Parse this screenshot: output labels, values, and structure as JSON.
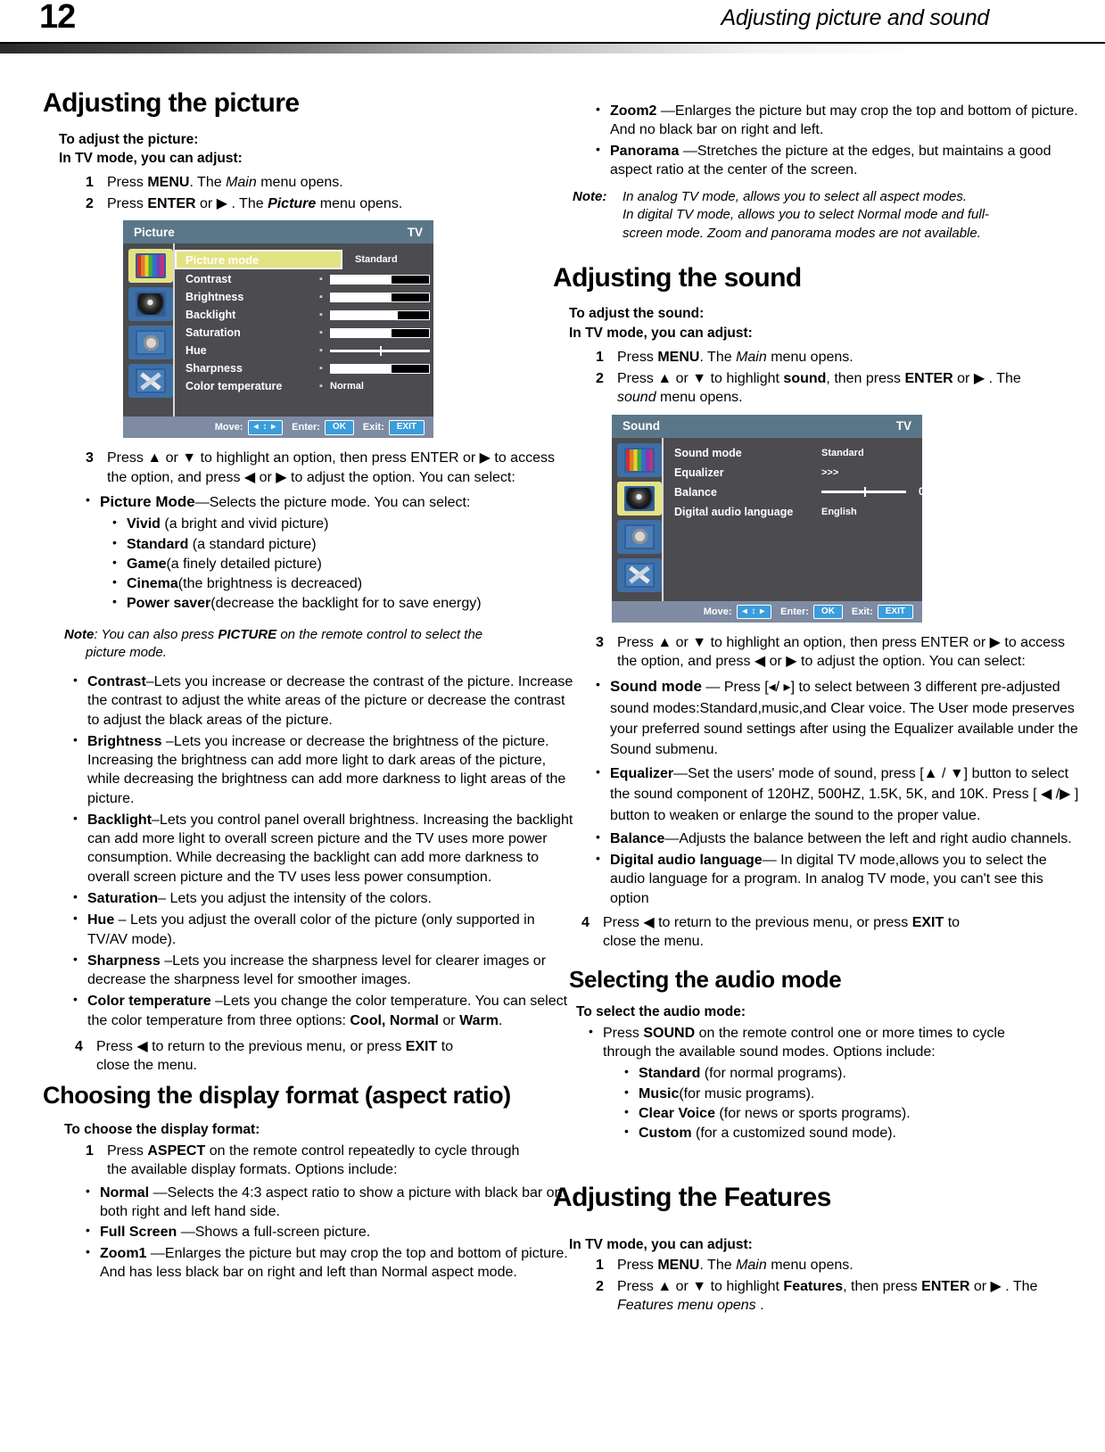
{
  "header": {
    "page_number": "12",
    "running_title": "Adjusting picture and sound"
  },
  "left_column": {
    "section_title": "Adjusting the picture",
    "lead1": "To adjust the picture:",
    "lead2": "In TV mode, you can adjust:",
    "steps": [
      {
        "num": "1",
        "text_1": "Press ",
        "bold_1": "MENU",
        "text_2": ". The ",
        "italic_1": "Main",
        "text_3": " menu opens."
      },
      {
        "num": "2",
        "text_1": "Press ",
        "bold_1": "ENTER",
        "text_2": " or ▶ . The ",
        "italic_1": "Picture",
        "text_3": "  menu opens."
      }
    ],
    "picture_osd": {
      "title": "Picture",
      "source": "TV",
      "rows": [
        {
          "label": "Picture mode",
          "value": "Standard",
          "type": "highlight"
        },
        {
          "label": "Contrast",
          "value": "50",
          "type": "bar",
          "fill_pct": 62
        },
        {
          "label": "Brightness",
          "value": "50",
          "type": "bar",
          "fill_pct": 62
        },
        {
          "label": "Backlight",
          "value": "5",
          "type": "bar",
          "fill_pct": 68
        },
        {
          "label": "Saturation",
          "value": "50",
          "type": "bar",
          "fill_pct": 62
        },
        {
          "label": "Hue",
          "value": "0",
          "type": "center",
          "fill_pct": 50
        },
        {
          "label": "Sharpness",
          "value": "5",
          "type": "bar",
          "fill_pct": 62
        },
        {
          "label": "Color temperature",
          "value": "Normal",
          "type": "text"
        }
      ],
      "footer": {
        "move_label": "Move:",
        "move_key": "◂ ↕ ▸",
        "enter_label": "Enter:",
        "enter_key": "OK",
        "exit_label": "Exit:",
        "exit_key": "EXIT"
      }
    },
    "step3": {
      "num": "3",
      "line1": "Press ▲ or ▼ to highlight an option, then press ENTER or ▶ to access",
      "line2": "the option, and press ◀ or ▶ to adjust  the option. You can select:"
    },
    "picture_mode_bullet": {
      "term": "Picture Mode",
      "desc": "—Selects the picture mode. You can select:",
      "options": [
        {
          "term": "Vivid",
          "desc": " (a bright and vivid picture)"
        },
        {
          "term": "Standard",
          "desc": " (a standard picture)"
        },
        {
          "term": "Game",
          "desc": "(a finely detailed picture)"
        },
        {
          "term": "Cinema",
          "desc": "(the brightness is decreaced)"
        },
        {
          "term": "Power saver",
          "desc": "(decrease the backlight for to save energy)"
        }
      ]
    },
    "note": {
      "label": "Note",
      "line1_a": ": You can also press ",
      "line1_b": "PICTURE",
      "line1_c": " on the remote control to select the",
      "line2": "picture mode."
    },
    "option_bullets": [
      {
        "term": "Contrast",
        "desc": "–Lets you increase or decrease the contrast of the picture. Increase the contrast to adjust the white areas of the picture or decrease the contrast to adjust the black areas of the picture."
      },
      {
        "term": "Brightness",
        "desc": " –Lets you increase or decrease the brightness of the picture. Increasing the brightness can add more light to dark areas of the picture, while decreasing the brightness can add more darkness to light areas of the picture."
      },
      {
        "term": "Backlight",
        "desc": "–Lets you control panel overall brightness. Increasing the backlight can add more light to overall screen picture and the TV uses more power consumption. While decreasing the backlight can add more darkness to overall screen picture and the TV uses less power consumption."
      },
      {
        "term": "Saturation",
        "desc": "– Lets you adjust the intensity of the colors."
      },
      {
        "term": "Hue",
        "desc": " – Lets you adjust the overall color of the picture (only supported in TV/AV mode)."
      },
      {
        "term": "Sharpness",
        "desc": " –Lets you increase the sharpness level for clearer images or decrease the sharpness level for smoother images."
      },
      {
        "term": "Color temperature",
        "desc": " –Lets you change the color temperature. You can select the color temperature from three options: ",
        "bold_tail": "Cool,  Normal",
        "tail_mid": " or ",
        "bold_tail2": "Warm",
        "tail_end": "."
      }
    ],
    "step4": {
      "num": "4",
      "line1_a": "Press ◀ to return to the previous menu, or press  ",
      "line1_b": "EXIT",
      "line1_c": " to",
      "line2": "close the menu."
    },
    "aspect_section": {
      "title": "Choosing the display format (aspect ratio)",
      "lead": "To choose the display format:",
      "step1": {
        "num": "1",
        "line1_a": "Press ",
        "line1_b": "ASPECT",
        "line1_c": " on the remote control repeatedly to cycle through",
        "line2": "the available display formats. Options include:"
      },
      "options": [
        {
          "term": "Normal",
          "desc": " —Selects the 4:3 aspect ratio to show a picture with black bar on both right and left hand side."
        },
        {
          "term": "Full Screen",
          "desc": " —Shows a full-screen picture."
        },
        {
          "term": "Zoom1",
          "desc": " —Enlarges the picture but may crop the top and bottom of picture. And has less black bar on right and left than Normal aspect mode."
        }
      ]
    }
  },
  "right_column": {
    "aspect_continued": [
      {
        "term": "Zoom2",
        "desc": " —Enlarges the picture but may crop the top and bottom of picture. And no black bar on right and left."
      },
      {
        "term": "Panorama",
        "desc": "   —Stretches the picture at the edges, but maintains a good aspect ratio at the center  of the screen."
      }
    ],
    "aspect_note": {
      "label": "Note:",
      "line1": "In analog TV mode, allows you to select all aspect modes.",
      "line2": "In digital TV mode, allows you to select Normal mode and full-",
      "line3": "screen mode. Zoom and panorama modes are not available."
    },
    "sound_section": {
      "title": "Adjusting the sound",
      "lead1": "To adjust the sound:",
      "lead2": "In TV mode, you can adjust:",
      "steps": [
        {
          "num": "1",
          "text_1": "Press ",
          "bold_1": "MENU",
          "text_2": ". The ",
          "italic_1": "Main",
          "text_3": " menu opens."
        },
        {
          "num": "2",
          "text_1": "Press ▲ or ▼ to highlight ",
          "bold_1": "sound",
          "text_2": ", then press ",
          "bold_2": "ENTER",
          "text_3": " or ▶ . The ",
          "italic_1": "sound",
          "text_4": " menu opens."
        }
      ],
      "sound_osd": {
        "title": "Sound",
        "source": "TV",
        "rows": [
          {
            "label": "Sound mode",
            "value": "Standard",
            "type": "text"
          },
          {
            "label": "Equalizer",
            "value": ">>>",
            "type": "text"
          },
          {
            "label": "Balance",
            "value": "0",
            "type": "center",
            "fill_pct": 50
          },
          {
            "label": "Digital audio language",
            "value": "English",
            "type": "text"
          }
        ],
        "footer": {
          "move_label": "Move:",
          "move_key": "◂ ↕ ▸",
          "enter_label": "Enter:",
          "enter_key": "OK",
          "exit_label": "Exit:",
          "exit_key": "EXIT"
        }
      },
      "step3": {
        "num": "3",
        "line1": "Press ▲ or ▼ to highlight an option, then press ENTER or ▶ to access",
        "line2": "the option, and press ◀ or ▶ to adjust  the option. You can select:"
      },
      "option_bullets": [
        {
          "term": "Sound mode",
          "desc": "  — Press [◂/ ▸] to select between 3 different pre-adjusted sound modes:Standard,music,and Clear voice. The User mode preserves your preferred sound settings after using the Equalizer available under the Sound submenu."
        },
        {
          "term": "Equalizer",
          "desc": "—Set the users' mode of sound, press [▲ / ▼] button to select the sound component of 120HZ, 500HZ, 1.5K, 5K, and 10K. Press [ ◀ /▶ ]  button to weaken or enlarge the sound to the proper value."
        },
        {
          "term": "Balance",
          "desc": "—Adjusts the balance between the left and right audio channels."
        },
        {
          "term": "Digital audio language",
          "desc": "—  In digital TV mode,allows you to select the audio language for a program. In analog TV mode, you can't see this option"
        }
      ],
      "step4": {
        "num": "4",
        "line1_a": "Press ◀    to return to the previous menu, or press  ",
        "line1_b": "EXIT",
        "line1_c": "  to",
        "line2": "close the menu."
      }
    },
    "audio_mode_section": {
      "title": "Selecting the audio mode",
      "lead": "To select the audio mode:",
      "bullet": {
        "line1_a": "Press ",
        "line1_b": "SOUND",
        "line1_c": " on the remote control one or more times to cycle",
        "line2": "through the available sound modes. Options include:"
      },
      "options": [
        {
          "term": "Standard",
          "desc": " (for normal programs)."
        },
        {
          "term": "Music",
          "desc": "(for music programs)."
        },
        {
          "term": "Clear Voice",
          "desc": " (for news or sports programs)."
        },
        {
          "term": "Custom",
          "desc": "  (for a customized sound mode)."
        }
      ]
    },
    "features_section": {
      "title": "Adjusting the Features",
      "lead": "In TV mode, you can adjust:",
      "steps": [
        {
          "num": "1",
          "text_1": "Press ",
          "bold_1": "MENU",
          "text_2": ". The ",
          "italic_1": "Main",
          "text_3": " menu opens."
        },
        {
          "num": "2",
          "text_1": "Press ▲ or ▼  to highlight ",
          "bold_1": "Features",
          "text_2": ", then press ",
          "bold_2": "ENTER",
          "text_3": " or ▶ . The ",
          "italic_1": "Features menu opens",
          "text_4": " ."
        }
      ]
    }
  }
}
